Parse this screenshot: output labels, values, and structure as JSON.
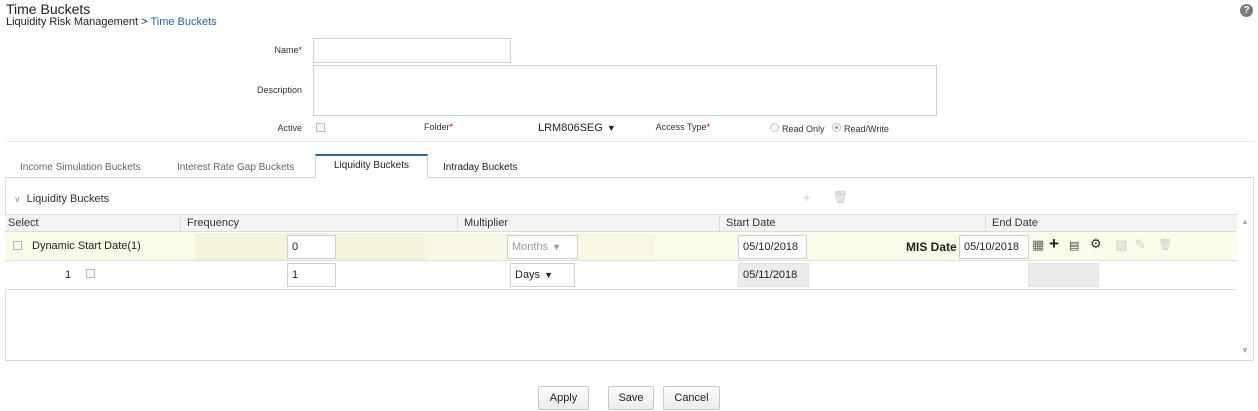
{
  "header": {
    "title": "Time Buckets",
    "breadcrumb_root": "Liquidity Risk Management",
    "breadcrumb_sep": ">",
    "breadcrumb_current": "Time Buckets",
    "help_icon": "help-icon"
  },
  "form": {
    "name_label": "Name",
    "description_label": "Description",
    "active_label": "Active",
    "folder_label": "Folder",
    "folder_value": "LRM806SEG",
    "access_type_label": "Access Type",
    "access_options": [
      "Read Only",
      "Read/Write"
    ],
    "access_selected": "Read/Write",
    "required_marker": "*"
  },
  "tabs": [
    {
      "label": "Income Simulation Buckets",
      "active": false
    },
    {
      "label": "Interest Rate Gap Buckets",
      "active": false
    },
    {
      "label": "Liquidity Buckets",
      "active": true
    },
    {
      "label": "Intraday Buckets",
      "active": false
    }
  ],
  "section": {
    "title": "Liquidity Buckets",
    "toolbar_icons": [
      "add-icon",
      "delete-icon"
    ]
  },
  "grid": {
    "columns": [
      "Select",
      "Frequency",
      "Multiplier",
      "Start Date",
      "End Date"
    ],
    "rows": [
      {
        "select_label": "Dynamic Start Date(1)",
        "frequency": "0",
        "multiplier": "Months",
        "start_date": "05/10/2018",
        "end_label": "MIS Date",
        "end_date": "05/10/2018"
      },
      {
        "select_label": "1",
        "frequency": "1",
        "multiplier": "Days",
        "start_date": "05/11/2018",
        "end_date": ""
      }
    ],
    "row_icons": [
      "calendar-icon",
      "plus-icon",
      "calculator-icon",
      "settings-icon",
      "image-icon",
      "edit-icon",
      "trash-icon"
    ]
  },
  "buttons": {
    "apply": "Apply",
    "save": "Save",
    "cancel": "Cancel"
  }
}
